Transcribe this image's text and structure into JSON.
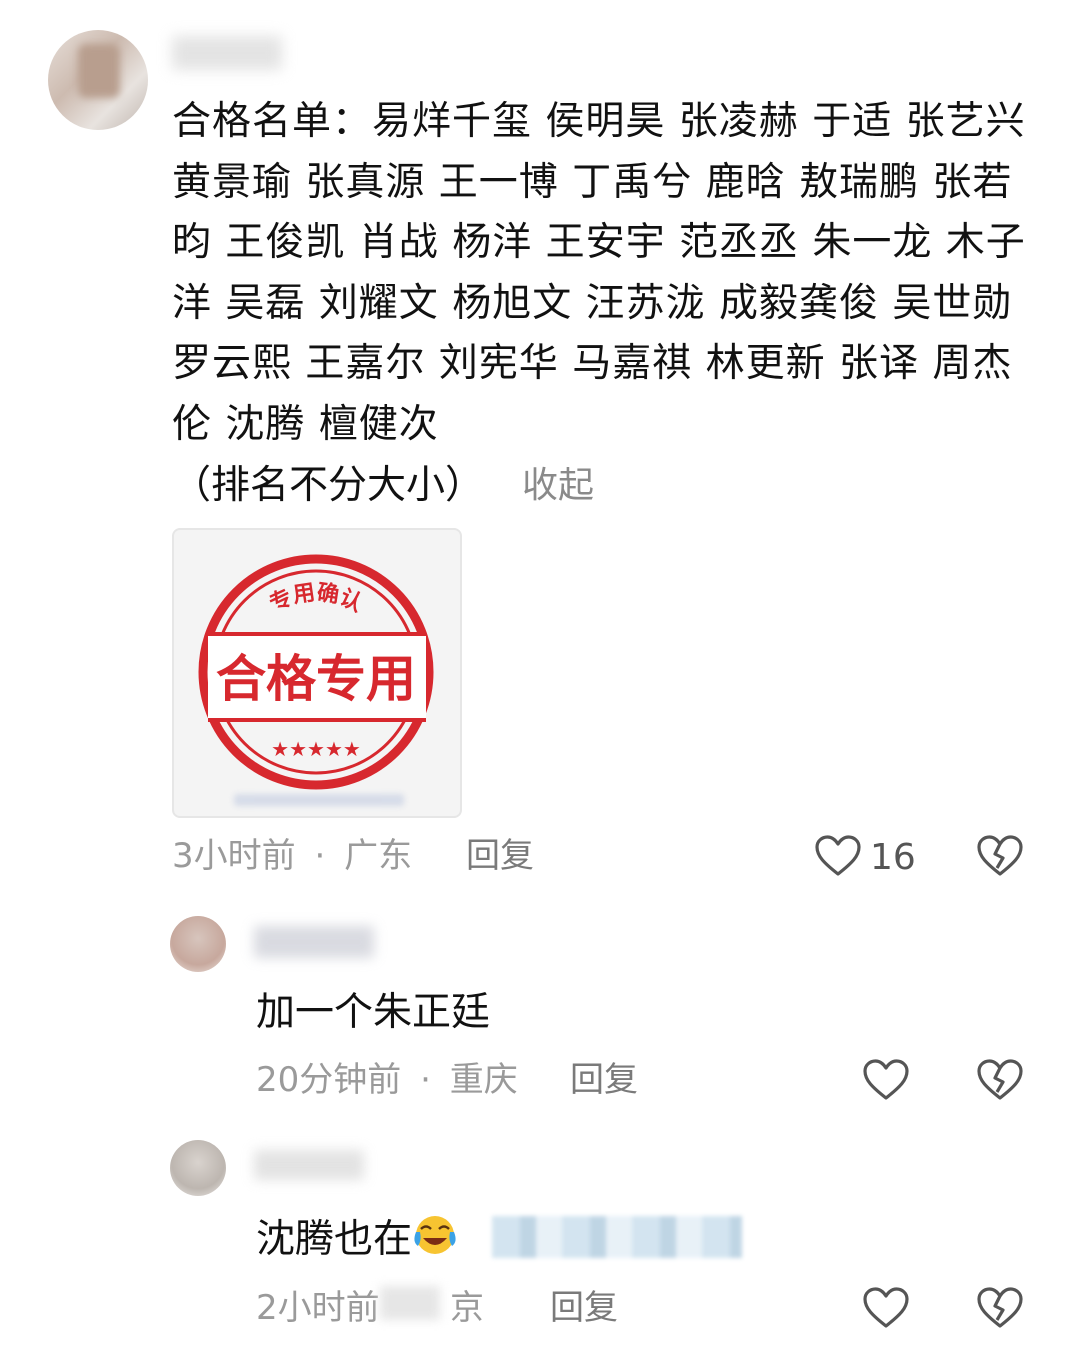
{
  "comment": {
    "text": "合格名单：易烊千玺 侯明昊 张凌赫 于适 张艺兴 黄景瑜 张真源 王一博 丁禹兮 鹿晗 敖瑞鹏 张若昀 王俊凯 肖战 杨洋 王安宇 范丞丞 朱一龙 木子洋 吴磊 刘耀文 杨旭文 汪苏泷 成毅龚俊 吴世勋 罗云熙 王嘉尔 刘宪华 马嘉祺 林更新 张译 周杰伦 沈腾 檀健次",
    "note": "（排名不分大小）",
    "collapse_label": "收起",
    "image": {
      "stamp_top_text": "专用确认",
      "stamp_main_text": "合格专用",
      "stamp_stars": "★★★★★",
      "stamp_color": "#d7282e"
    },
    "time": "3小时前",
    "separator": "·",
    "location": "广东",
    "reply_label": "回复",
    "like_count": "16"
  },
  "replies": [
    {
      "text": "加一个朱正廷",
      "time": "20分钟前",
      "separator": "·",
      "location": "重庆",
      "reply_label": "回复"
    },
    {
      "text": "沈腾也在",
      "emoji": "😂",
      "time": "2小时前",
      "location": "京",
      "reply_label": "回复"
    }
  ],
  "icons": {
    "like": "heart-outline-icon",
    "dislike": "broken-heart-icon"
  }
}
